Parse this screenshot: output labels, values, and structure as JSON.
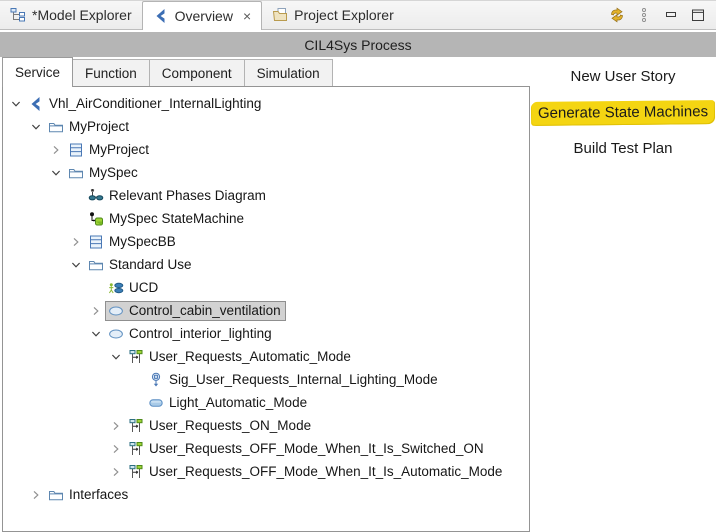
{
  "window": {
    "tabs": [
      {
        "label": "*Model Explorer",
        "icon": "model-explorer-icon",
        "active": false,
        "closable": false
      },
      {
        "label": "Overview",
        "icon": "overview-icon",
        "active": true,
        "closable": true,
        "close_glyph": "×"
      },
      {
        "label": "Project Explorer",
        "icon": "project-explorer-icon",
        "active": false,
        "closable": false
      }
    ],
    "toolbar": [
      {
        "icon": "sync-icon"
      },
      {
        "icon": "view-menu-icon"
      },
      {
        "icon": "minimize-icon"
      },
      {
        "icon": "maximize-icon"
      }
    ]
  },
  "header": {
    "title": "CIL4Sys Process"
  },
  "subtabs": [
    {
      "label": "Service",
      "active": true
    },
    {
      "label": "Function",
      "active": false
    },
    {
      "label": "Component",
      "active": false
    },
    {
      "label": "Simulation",
      "active": false
    }
  ],
  "actions": [
    {
      "label": "New User Story",
      "highlighted": false
    },
    {
      "label": "Generate State Machines",
      "highlighted": true
    },
    {
      "label": "Build Test Plan",
      "highlighted": false
    }
  ],
  "tree": [
    {
      "label": "Vhl_AirConditioner_InternalLighting",
      "level": 0,
      "expand": "expanded",
      "icon": "system-icon",
      "selected": false
    },
    {
      "label": "MyProject",
      "level": 1,
      "expand": "expanded",
      "icon": "folder-icon",
      "selected": false
    },
    {
      "label": "MyProject",
      "level": 2,
      "expand": "collapsed",
      "icon": "table-icon",
      "selected": false
    },
    {
      "label": "MySpec",
      "level": 2,
      "expand": "expanded",
      "icon": "folder-icon",
      "selected": false
    },
    {
      "label": "Relevant Phases Diagram",
      "level": 3,
      "expand": "none",
      "icon": "phases-diagram-icon",
      "selected": false
    },
    {
      "label": "MySpec StateMachine",
      "level": 3,
      "expand": "none",
      "icon": "statemachine-icon",
      "selected": false
    },
    {
      "label": "MySpecBB",
      "level": 3,
      "expand": "collapsed",
      "icon": "table-icon",
      "selected": false
    },
    {
      "label": "Standard Use",
      "level": 3,
      "expand": "expanded",
      "icon": "folder-icon",
      "selected": false
    },
    {
      "label": "UCD",
      "level": 4,
      "expand": "none",
      "icon": "usecase-diagram-icon",
      "selected": false
    },
    {
      "label": "Control_cabin_ventilation",
      "level": 4,
      "expand": "collapsed",
      "icon": "usecase-icon",
      "selected": true
    },
    {
      "label": "Control_interior_lighting",
      "level": 4,
      "expand": "expanded",
      "icon": "usecase-icon",
      "selected": false
    },
    {
      "label": "User_Requests_Automatic_Mode",
      "level": 5,
      "expand": "expanded",
      "icon": "sequence-icon",
      "selected": false
    },
    {
      "label": "Sig_User_Requests_Internal_Lighting_Mode",
      "level": 6,
      "expand": "none",
      "icon": "signal-icon",
      "selected": false
    },
    {
      "label": "Light_Automatic_Mode",
      "level": 6,
      "expand": "none",
      "icon": "state-icon",
      "selected": false
    },
    {
      "label": "User_Requests_ON_Mode",
      "level": 5,
      "expand": "collapsed",
      "icon": "sequence-icon",
      "selected": false
    },
    {
      "label": "User_Requests_OFF_Mode_When_It_Is_Switched_ON",
      "level": 5,
      "expand": "collapsed",
      "icon": "sequence-icon",
      "selected": false
    },
    {
      "label": "User_Requests_OFF_Mode_When_It_Is_Automatic_Mode",
      "level": 5,
      "expand": "collapsed",
      "icon": "sequence-icon",
      "selected": false
    },
    {
      "label": "Interfaces",
      "level": 1,
      "expand": "collapsed",
      "icon": "folder-icon",
      "selected": false
    }
  ],
  "colors": {
    "header_bg": "#b5b5b5",
    "highlight_yellow": "#f4d512",
    "selection_bg": "#d2d2d2",
    "selection_border": "#8f8f8f",
    "accent_blue": "#3c6eb4",
    "sync_gold": "#e3b32a"
  }
}
